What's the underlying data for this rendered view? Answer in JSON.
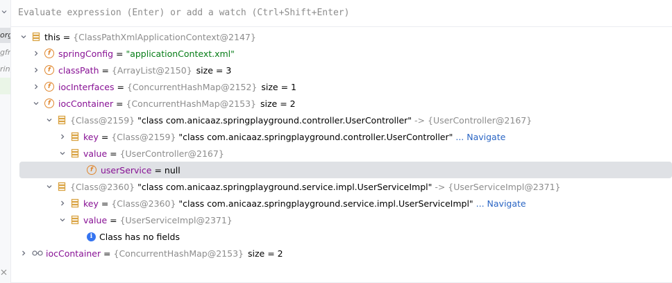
{
  "left_panel": {
    "fragments": [
      "org",
      "gfr",
      "ring"
    ]
  },
  "evaluate": {
    "placeholder": "Evaluate expression (Enter) or add a watch (Ctrl+Shift+Enter)"
  },
  "tree": {
    "this": {
      "name": "this",
      "eq": " = ",
      "ref": "{ClassPathXmlApplicationContext@2147}"
    },
    "springConfig": {
      "name": "springConfig",
      "eq": " = ",
      "value": "\"applicationContext.xml\""
    },
    "classPath": {
      "name": "classPath",
      "eq": " = ",
      "ref": "{ArrayList@2150}",
      "size": "size = 3"
    },
    "iocInterfaces": {
      "name": "iocInterfaces",
      "eq": " = ",
      "ref": "{ConcurrentHashMap@2152}",
      "size": "size = 1"
    },
    "iocContainer": {
      "name": "iocContainer",
      "eq": " = ",
      "ref": "{ConcurrentHashMap@2153}",
      "size": "size = 2"
    },
    "entry1": {
      "ref": "{Class@2159}",
      "value": " \"class com.anicaaz.springplayground.controller.UserController\"",
      "arrow": " -> ",
      "target": "{UserController@2167}",
      "key": {
        "name": "key",
        "eq": " = ",
        "ref": "{Class@2159}",
        "value": " \"class com.anicaaz.springplayground.controller.UserController\"",
        "nav": " ... Navigate"
      },
      "val": {
        "name": "value",
        "eq": " = ",
        "ref": "{UserController@2167}"
      },
      "userService": {
        "name": "userService",
        "eq": " = ",
        "value": "null"
      }
    },
    "entry2": {
      "ref": "{Class@2360}",
      "value": " \"class com.anicaaz.springplayground.service.impl.UserServiceImpl\"",
      "arrow": " -> ",
      "target": "{UserServiceImpl@2371}",
      "key": {
        "name": "key",
        "eq": " = ",
        "ref": "{Class@2360}",
        "value": " \"class com.anicaaz.springplayground.service.impl.UserServiceImpl\"",
        "nav": " ... Navigate"
      },
      "val": {
        "name": "value",
        "eq": " = ",
        "ref": "{UserServiceImpl@2371}"
      },
      "no_fields": "Class has no fields"
    },
    "watch": {
      "name": "iocContainer",
      "eq": " = ",
      "ref": "{ConcurrentHashMap@2153}",
      "size": "size = 2"
    }
  },
  "colors": {
    "field_name": "#871094",
    "string_value": "#067d17",
    "reference": "#8c8c8c",
    "navigate_link": "#2a65c4",
    "icon_orange": "#e0862c",
    "selection": "#dfe1e5"
  }
}
